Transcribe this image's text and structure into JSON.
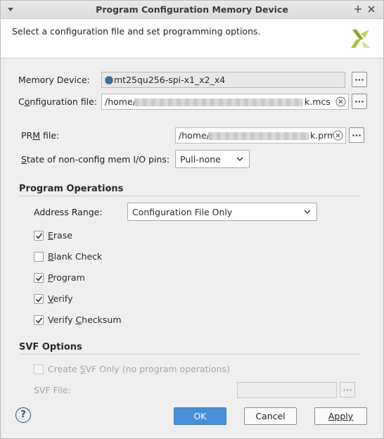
{
  "window": {
    "title": "Program Configuration Memory Device"
  },
  "header": {
    "description": "Select a configuration file and set programming options."
  },
  "memory_device": {
    "label": "Memory Device:",
    "value": "mt25qu256-spi-x1_x2_x4"
  },
  "config_file": {
    "label_pre": "C",
    "label_ul": "o",
    "label_post": "nfiguration file:",
    "value_prefix": "/home/",
    "value_suffix": "k.mcs"
  },
  "prm_file": {
    "label_pre": "PR",
    "label_ul": "M",
    "label_post": " file:",
    "value_prefix": "/home/",
    "value_suffix": "k.prm"
  },
  "pin_state": {
    "label_pre": "",
    "label_ul": "S",
    "label_post": "tate of non-config mem I/O pins:",
    "value": "Pull-none"
  },
  "program_operations": {
    "heading": "Program Operations",
    "address_range_label": "Address Range:",
    "address_range_value": "Configuration File Only",
    "options": [
      {
        "pre": "",
        "ul": "E",
        "post": "rase",
        "checked": true
      },
      {
        "pre": "",
        "ul": "B",
        "post": "lank Check",
        "checked": false
      },
      {
        "pre": "",
        "ul": "P",
        "post": "rogram",
        "checked": true
      },
      {
        "pre": "",
        "ul": "V",
        "post": "erify",
        "checked": true
      },
      {
        "pre": "Verify ",
        "ul": "C",
        "post": "hecksum",
        "checked": true
      }
    ]
  },
  "svf_options": {
    "heading": "SVF Options",
    "create_svf_pre": "Create ",
    "create_svf_ul": "S",
    "create_svf_post": "VF Only (no program operations)",
    "svf_file_label": "SVF File:"
  },
  "buttons": {
    "help": "?",
    "ok": "OK",
    "cancel": "Cancel",
    "apply": "Apply"
  }
}
